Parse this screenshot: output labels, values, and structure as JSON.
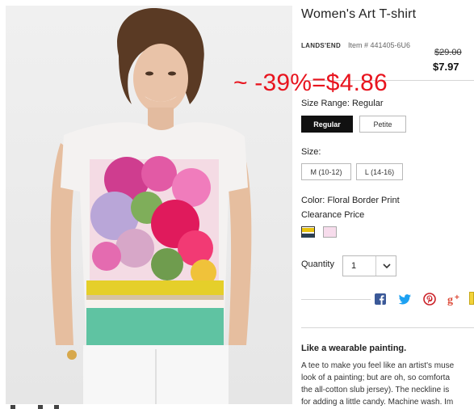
{
  "product": {
    "title": "Women's Art T-shirt",
    "brand": "LANDS'END",
    "item_number": "Item # 441405-6U6",
    "original_price": "$29.00",
    "sale_price": "$7.97"
  },
  "overlay_text": "~ -39%=$4.86",
  "size_range": {
    "label": "Size Range: Regular",
    "options": [
      "Regular",
      "Petite"
    ],
    "selected": "Regular"
  },
  "size": {
    "label": "Size:",
    "options": [
      "M (10-12)",
      "L (14-16)"
    ]
  },
  "color": {
    "label": "Color: Floral Border Print",
    "sub_label": "Clearance Price",
    "swatches": [
      {
        "name": "floral-border-print",
        "color": "#e8c20c"
      },
      {
        "name": "pink",
        "color": "#f7dcec"
      }
    ]
  },
  "quantity": {
    "label": "Quantity",
    "value": "1"
  },
  "social": [
    "facebook-icon",
    "twitter-icon",
    "pinterest-icon",
    "google-plus-icon"
  ],
  "description": {
    "title": "Like a wearable painting.",
    "lines": [
      "A tee to make you feel like an artist's muse",
      "look of a painting; but are oh, so comforta",
      "the all-cotton slub jersey). The neckline is",
      "for adding a little candy. Machine wash. Im"
    ]
  },
  "colors": {
    "accent_red": "#e8141e",
    "facebook": "#3b5998",
    "twitter": "#1da1f2",
    "pinterest": "#cb2027",
    "google_plus": "#dd4b39"
  }
}
